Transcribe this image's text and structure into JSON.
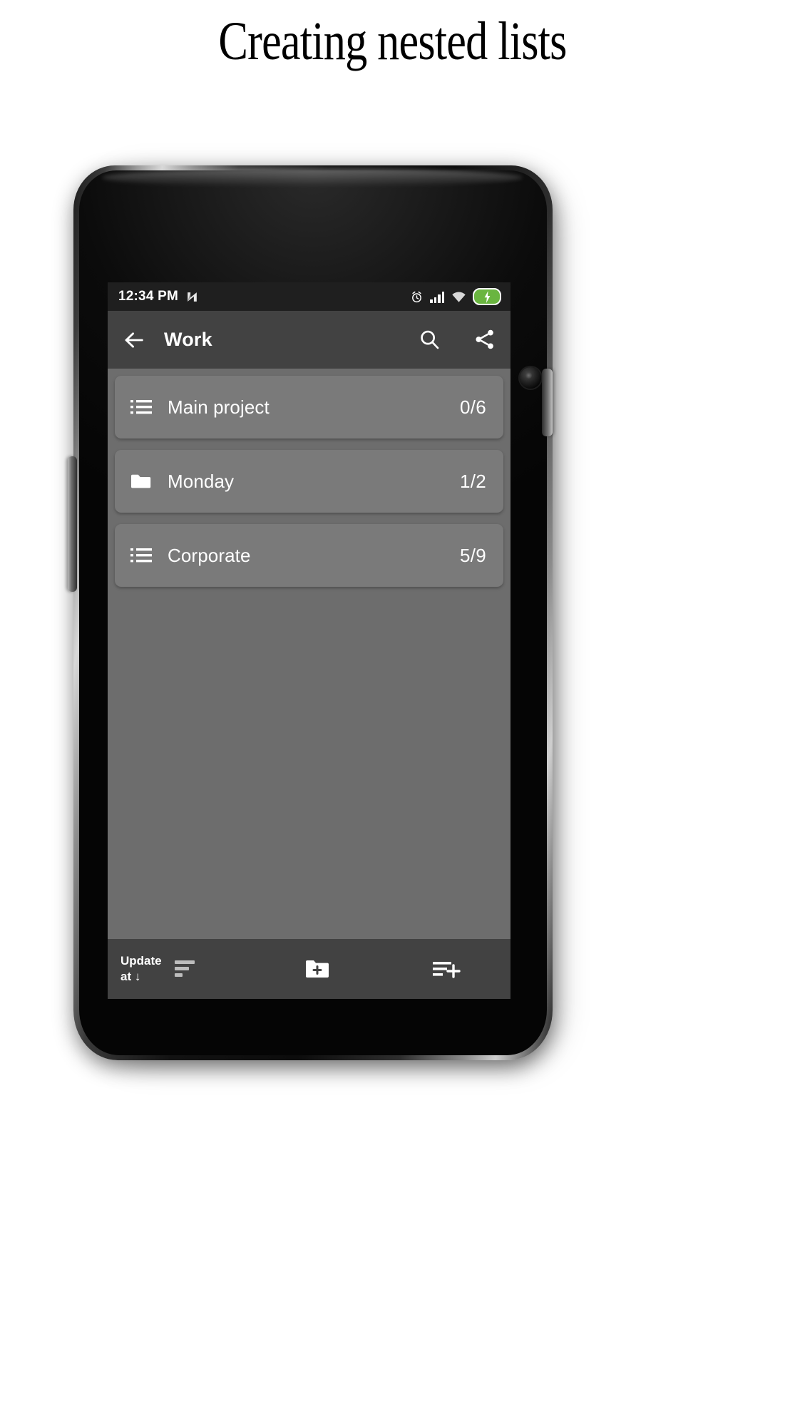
{
  "headline": "Creating nested lists",
  "phone": {
    "hardware": {
      "earpiece": "earpiece-speaker",
      "front_camera": "front-camera",
      "proximity_sensor": "proximity-sensor",
      "volume_button": "volume-rocker",
      "power_button": "power-button"
    }
  },
  "status_bar": {
    "time": "12:34 PM",
    "launcher_icon": "nova-n-icon",
    "icons": [
      "alarm-icon",
      "signal-icon",
      "wifi-icon",
      "battery-charging-icon"
    ],
    "battery_color": "#6ab540",
    "background": "#1f1f1f"
  },
  "app_bar": {
    "back_icon": "back-arrow-icon",
    "title": "Work",
    "search_icon": "search-icon",
    "share_icon": "share-icon",
    "background": "#424242"
  },
  "list": {
    "background": "#6d6d6d",
    "card_color": "#7a7a7a",
    "items": [
      {
        "icon": "list-icon",
        "label": "Main project",
        "count": "0/6"
      },
      {
        "icon": "folder-icon",
        "label": "Monday",
        "count": "1/2"
      },
      {
        "icon": "list-icon",
        "label": "Corporate",
        "count": "5/9"
      }
    ]
  },
  "bottom_bar": {
    "background": "#424242",
    "sort_label_line1": "Update",
    "sort_label_line2": "at",
    "sort_arrow": "↓",
    "sort_icon": "sort-descending-icon",
    "new_folder_icon": "new-folder-icon",
    "add_list_icon": "add-list-icon"
  }
}
